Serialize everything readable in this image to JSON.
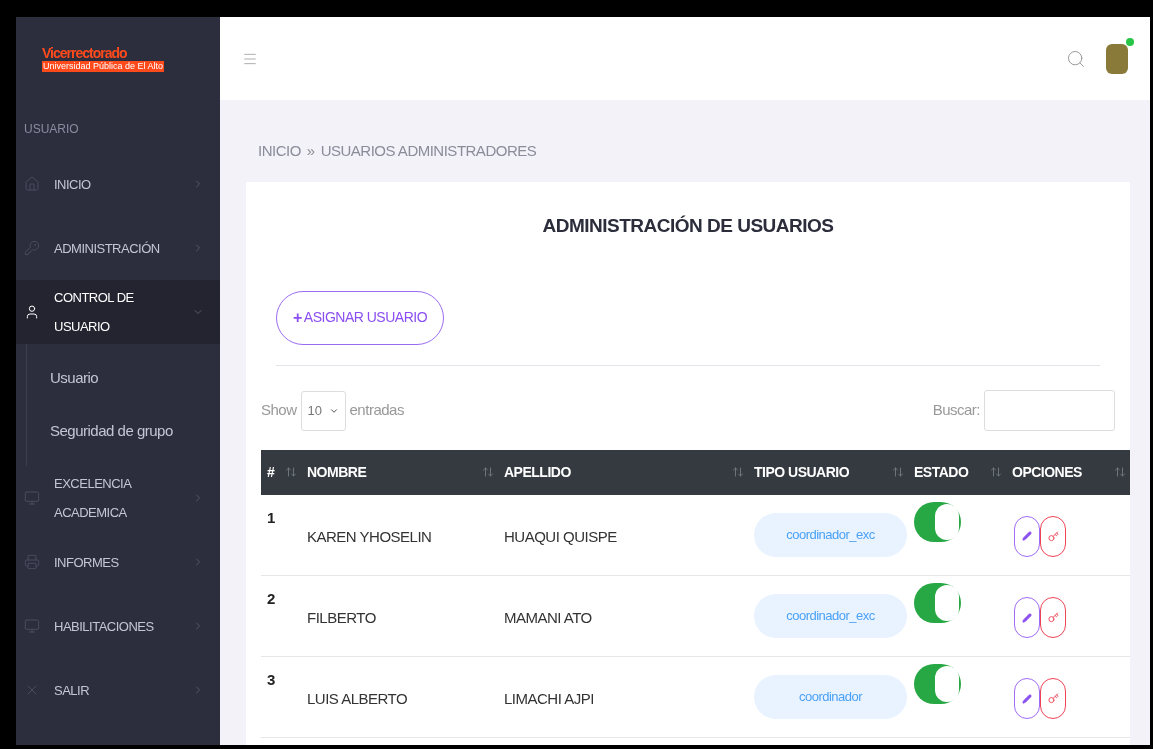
{
  "sidebar": {
    "logo": {
      "title": "Vicerrectorado",
      "subtitle": "Universidad Pública de El Alto"
    },
    "section_label": "USUARIO",
    "items": [
      {
        "label": "INICIO",
        "selected": false,
        "expanded": false
      },
      {
        "label": "ADMINISTRACIÓN",
        "selected": false,
        "expanded": false
      },
      {
        "label": "CONTROL DE USUARIO",
        "selected": true,
        "expanded": true,
        "children": [
          {
            "label": "Usuario"
          },
          {
            "label": "Seguridad de grupo"
          }
        ]
      },
      {
        "label": "EXCELENCIA ACADEMICA",
        "selected": false,
        "expanded": false
      },
      {
        "label": "INFORMES",
        "selected": false,
        "expanded": false
      },
      {
        "label": "HABILITACIONES",
        "selected": false,
        "expanded": false
      },
      {
        "label": "SALIR",
        "selected": false,
        "expanded": false
      }
    ]
  },
  "header": {
    "online": true
  },
  "breadcrumb": [
    "INICIO",
    "»",
    "USUARIOS ADMINISTRADORES"
  ],
  "card": {
    "title": "ADMINISTRACIÓN DE USUARIOS",
    "add_button": {
      "icon": "+",
      "label": "ASIGNAR USUARIO"
    },
    "length": {
      "before": "Show",
      "value": "10",
      "after": "entradas"
    },
    "search_label": "Buscar:",
    "table": {
      "columns": [
        "#",
        "NOMBRE",
        "APELLIDO",
        "TIPO USUARIO",
        "ESTADO",
        "OPCIONES"
      ],
      "rows": [
        {
          "number": "1",
          "nombre": "KAREN YHOSELIN",
          "apellido": "HUAQUI QUISPE",
          "tipo": "coordinador_exc",
          "on": true
        },
        {
          "number": "2",
          "nombre": "FILBERTO",
          "apellido": "MAMANI ATO",
          "tipo": "coordinador_exc",
          "on": true
        },
        {
          "number": "3",
          "nombre": "LUIS ALBERTO",
          "apellido": "LIMACHI AJPI",
          "tipo": "coordinador",
          "on": true
        }
      ]
    }
  }
}
